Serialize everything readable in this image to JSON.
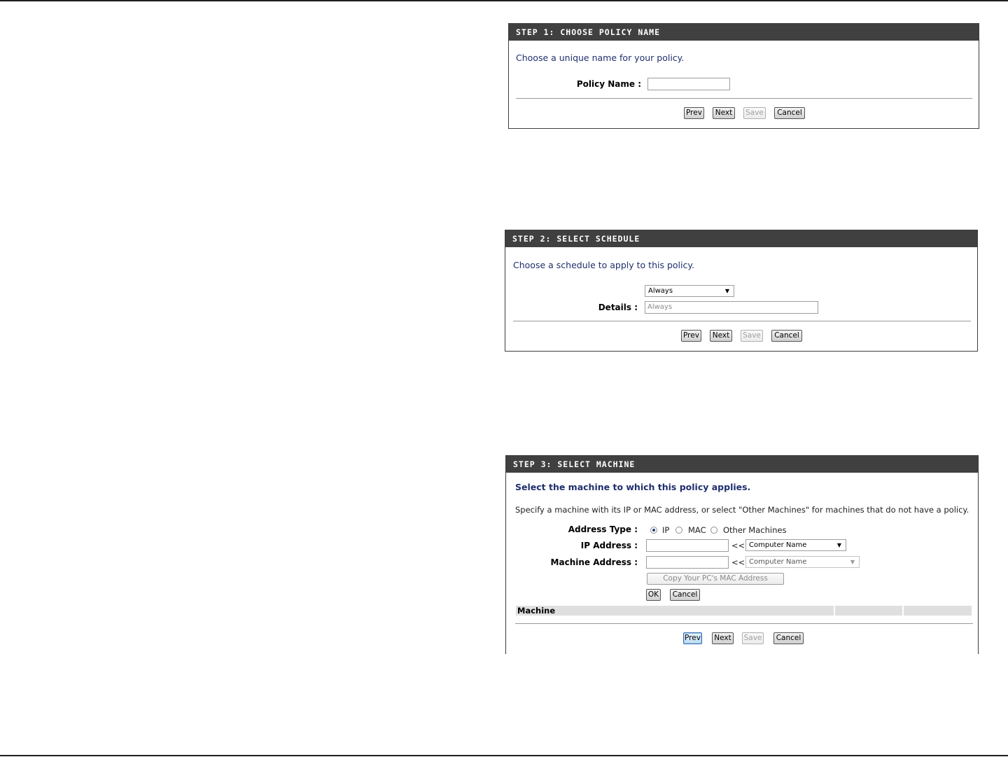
{
  "step1": {
    "header": "STEP 1: CHOOSE POLICY NAME",
    "intro": "Choose a unique name for your policy.",
    "policy_name_label": "Policy Name :",
    "policy_name_value": "",
    "buttons": {
      "prev": "Prev",
      "next": "Next",
      "save": "Save",
      "cancel": "Cancel"
    }
  },
  "step2": {
    "header": "STEP 2: SELECT SCHEDULE",
    "intro": "Choose a schedule to apply to this policy.",
    "schedule_selected": "Always",
    "details_label": "Details :",
    "details_value": "Always",
    "buttons": {
      "prev": "Prev",
      "next": "Next",
      "save": "Save",
      "cancel": "Cancel"
    }
  },
  "step3": {
    "header": "STEP 3: SELECT MACHINE",
    "intro": "Select the machine to which this policy applies.",
    "description": "Specify a machine with its IP or MAC address, or select \"Other Machines\" for machines that do not have a policy.",
    "address_type_label": "Address Type :",
    "address_types": [
      "IP",
      "MAC",
      "Other Machines"
    ],
    "address_type_selected": "IP",
    "ip_address_label": "IP Address :",
    "ip_address_value": "",
    "machine_address_label": "Machine Address :",
    "machine_address_value": "",
    "arrow_symbol": "<<",
    "ip_computer_select": "Computer Name",
    "mac_computer_select": "Computer Name",
    "copy_mac_button": "Copy Your PC's MAC Address",
    "ok_button": "OK",
    "cancel_small_button": "Cancel",
    "table_header": "Machine",
    "buttons": {
      "prev": "Prev",
      "next": "Next",
      "save": "Save",
      "cancel": "Cancel"
    }
  },
  "colors": {
    "header_bg": "#404040",
    "header_text": "#ffffff",
    "intro_text": "#1f2f6e",
    "table_header_bg": "#dfdfdf"
  },
  "icons": {
    "dropdown": "dropdown-arrow-icon"
  }
}
